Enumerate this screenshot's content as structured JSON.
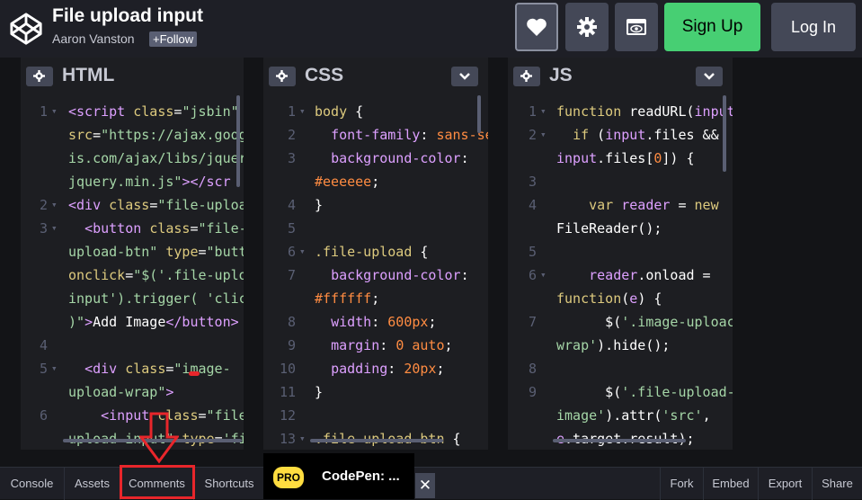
{
  "header": {
    "title": "File upload input",
    "author": "Aaron Vanston",
    "follow_label": "+Follow",
    "signup_label": "Sign Up",
    "login_label": "Log In"
  },
  "panels": {
    "html": {
      "label": "HTML",
      "lines": [
        {
          "n": "1",
          "fold": true,
          "html": "<span class='tag'>&lt;script</span> <span class='sel'>class</span>=<span class='str'>\"jsbin\"</span>"
        },
        {
          "n": "",
          "fold": false,
          "html": "<span class='sel'>src</span>=<span class='str'>\"https://ajax.goog</span>"
        },
        {
          "n": "",
          "fold": false,
          "html": "<span class='str'>is.com/ajax/libs/jquer</span>"
        },
        {
          "n": "",
          "fold": false,
          "html": "<span class='str'>jquery.min.js\"</span><span class='tag'>&gt;&lt;/scr</span>"
        },
        {
          "n": "2",
          "fold": true,
          "html": "<span class='tag'>&lt;div</span> <span class='sel'>class</span>=<span class='str'>\"file-uploa</span>"
        },
        {
          "n": "3",
          "fold": true,
          "html": "  <span class='tag'>&lt;button</span> <span class='sel'>class</span>=<span class='str'>\"file-</span>"
        },
        {
          "n": "",
          "fold": false,
          "html": "<span class='str'>upload-btn\"</span> <span class='sel'>type</span>=<span class='str'>\"butt</span>"
        },
        {
          "n": "",
          "fold": false,
          "html": "<span class='sel'>onclick</span>=<span class='str'>\"$('.file-uplo</span>"
        },
        {
          "n": "",
          "fold": false,
          "html": "<span class='str'>input').trigger( 'clic</span>"
        },
        {
          "n": "",
          "fold": false,
          "html": "<span class='str'>)\"</span><span class='tag'>&gt;</span>Add Image<span class='tag'>&lt;/button&gt;</span>"
        },
        {
          "n": "4",
          "fold": false,
          "html": ""
        },
        {
          "n": "5",
          "fold": true,
          "html": "  <span class='tag'>&lt;div</span> <span class='sel'>class</span>=<span class='str'>\"image-</span>"
        },
        {
          "n": "",
          "fold": false,
          "html": "<span class='str'>upload-wrap\"</span><span class='tag'>&gt;</span>"
        },
        {
          "n": "6",
          "fold": false,
          "html": "    <span class='tag'>&lt;input</span> <span class='sel'>class</span>=<span class='str'>\"file</span>"
        },
        {
          "n": "",
          "fold": false,
          "html": "<span class='str'>upload-input\"</span> <span class='sel'>type</span>=<span class='str'>'fi</span>"
        }
      ]
    },
    "css": {
      "label": "CSS",
      "lines": [
        {
          "n": "1",
          "fold": true,
          "html": "<span class='sel'>body</span> {"
        },
        {
          "n": "2",
          "fold": false,
          "html": "  <span class='tag'>font-family</span>: <span class='val'>sans-se</span>"
        },
        {
          "n": "3",
          "fold": false,
          "html": "  <span class='tag'>background-color</span>:"
        },
        {
          "n": "",
          "fold": false,
          "html": "<span class='val'>#eeeeee</span>;"
        },
        {
          "n": "4",
          "fold": false,
          "html": "}"
        },
        {
          "n": "5",
          "fold": false,
          "html": ""
        },
        {
          "n": "6",
          "fold": true,
          "html": "<span class='sel'>.file-upload</span> {"
        },
        {
          "n": "7",
          "fold": false,
          "html": "  <span class='tag'>background-color</span>:"
        },
        {
          "n": "",
          "fold": false,
          "html": "<span class='val'>#ffffff</span>;"
        },
        {
          "n": "8",
          "fold": false,
          "html": "  <span class='tag'>width</span>: <span class='val'>600px</span>;"
        },
        {
          "n": "9",
          "fold": false,
          "html": "  <span class='tag'>margin</span>: <span class='val'>0 auto</span>;"
        },
        {
          "n": "10",
          "fold": false,
          "html": "  <span class='tag'>padding</span>: <span class='val'>20px</span>;"
        },
        {
          "n": "11",
          "fold": false,
          "html": "}"
        },
        {
          "n": "12",
          "fold": false,
          "html": ""
        },
        {
          "n": "13",
          "fold": true,
          "html": "<span class='sel'>.file-upload-btn</span> {"
        }
      ]
    },
    "js": {
      "label": "JS",
      "lines": [
        {
          "n": "1",
          "fold": true,
          "html": "<span class='kw'>function</span> readURL(<span class='tag'>input</span>"
        },
        {
          "n": "2",
          "fold": true,
          "html": "  <span class='kw'>if</span> (<span class='tag'>input</span>.files &amp;&amp;"
        },
        {
          "n": "",
          "fold": false,
          "html": "<span class='tag'>input</span>.files[<span class='val'>0</span>]) {"
        },
        {
          "n": "3",
          "fold": false,
          "html": ""
        },
        {
          "n": "4",
          "fold": false,
          "html": "    <span class='kw'>var</span> <span class='tag'>reader</span> = <span class='kw'>new</span>"
        },
        {
          "n": "",
          "fold": false,
          "html": "FileReader();"
        },
        {
          "n": "5",
          "fold": false,
          "html": ""
        },
        {
          "n": "6",
          "fold": true,
          "html": "    <span class='tag'>reader</span>.onload ="
        },
        {
          "n": "",
          "fold": false,
          "html": "<span class='kw'>function</span>(<span class='tag'>e</span>) {"
        },
        {
          "n": "7",
          "fold": false,
          "html": "      $(<span class='str'>'.image-uploac</span>"
        },
        {
          "n": "",
          "fold": false,
          "html": "<span class='str'>wrap'</span>).hide();"
        },
        {
          "n": "8",
          "fold": false,
          "html": ""
        },
        {
          "n": "9",
          "fold": false,
          "html": "      $(<span class='str'>'.file-upload-</span>"
        },
        {
          "n": "",
          "fold": false,
          "html": "<span class='str'>image'</span>).attr(<span class='str'>'src'</span>,"
        },
        {
          "n": "",
          "fold": false,
          "html": "<span class='tag'>e</span>.target.result);"
        }
      ]
    }
  },
  "bottom": {
    "console": "Console",
    "assets": "Assets",
    "comments": "Comments",
    "shortcuts": "Shortcuts",
    "pro_badge": "PRO",
    "pro_text": "CodePen: ...",
    "close": "✕",
    "fork": "Fork",
    "embed": "Embed",
    "export": "Export",
    "share": "Share"
  },
  "icons": [
    "codepen-logo-icon",
    "heart-icon",
    "gear-icon",
    "change-view-icon",
    "settings-icon",
    "chevron-down-icon",
    "close-icon",
    "arrow-down-icon"
  ],
  "colors": {
    "signup": "#47cf73",
    "annotation": "#e8262b",
    "pro": "#ffdd40"
  }
}
